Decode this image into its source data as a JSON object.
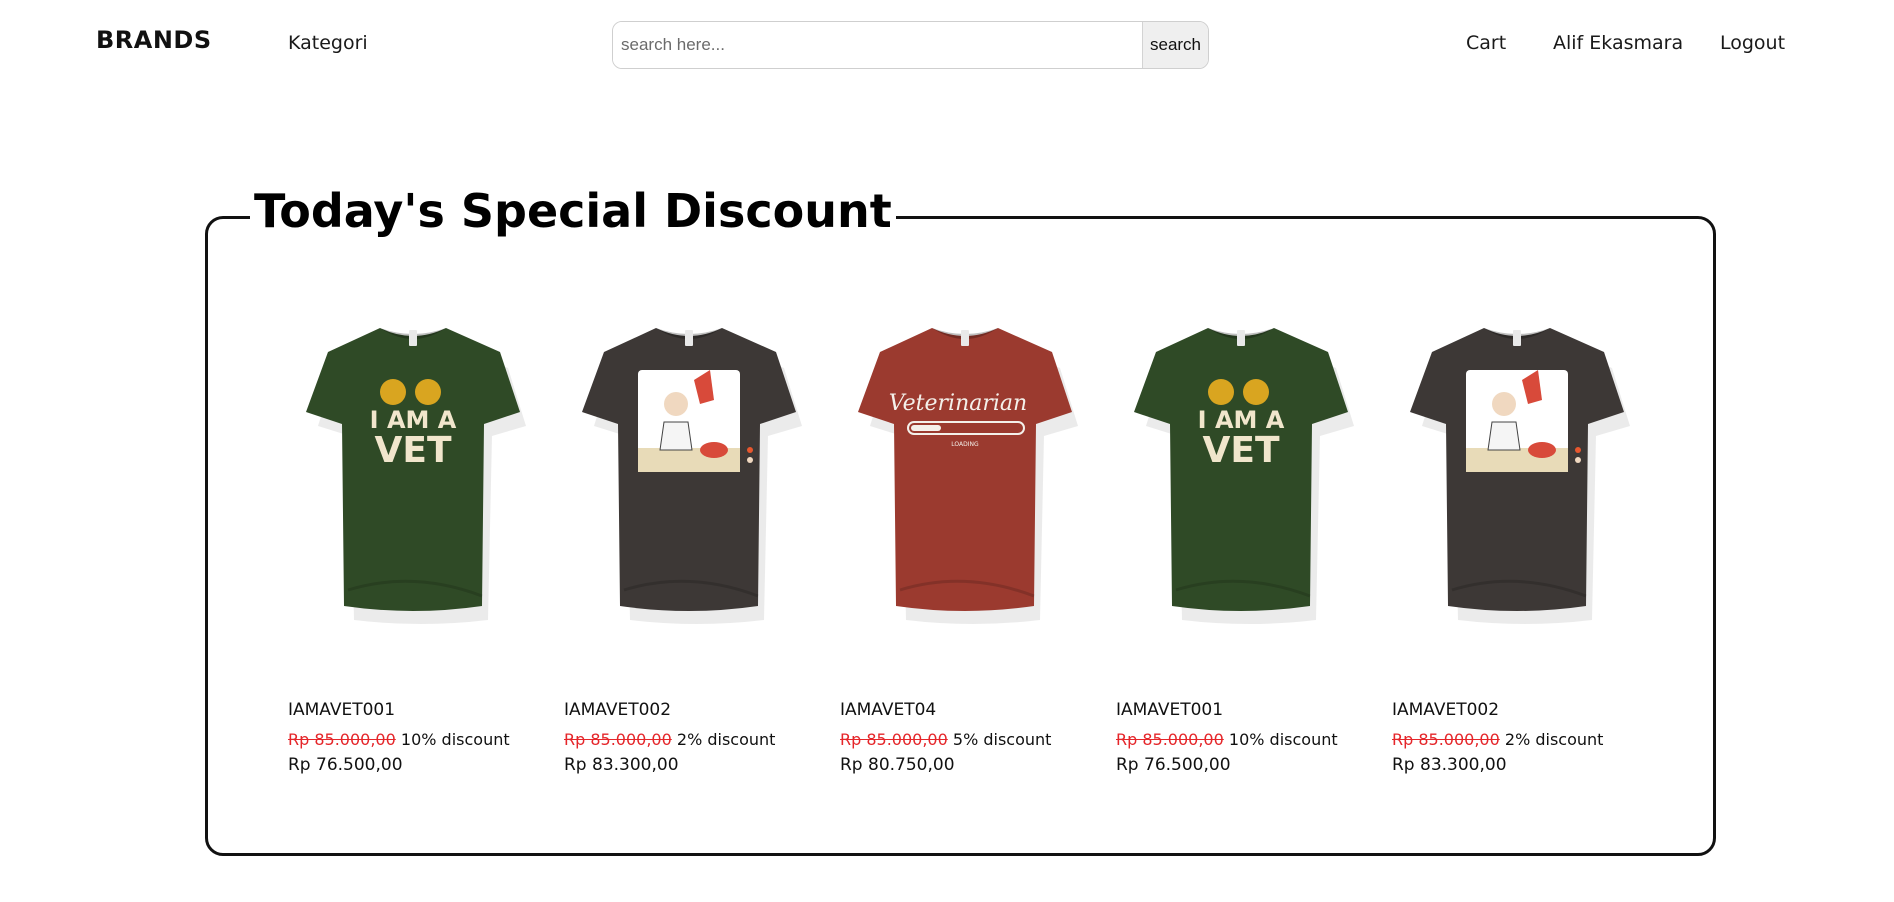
{
  "nav": {
    "brand": "BRANDS",
    "kategori": "Kategori",
    "search_placeholder": "search here...",
    "search_button": "search",
    "cart": "Cart",
    "user": "Alif Ekasmara",
    "logout": "Logout"
  },
  "section": {
    "title": "Today's Special Discount"
  },
  "products": [
    {
      "name": "IAMAVET001",
      "old_price": "Rp 85.000,00",
      "discount": "10% discount",
      "price": "Rp 76.500,00",
      "color": "#2f4a26",
      "design": "i-am-a-vet",
      "design_text_1": "I AM A",
      "design_text_2": "VET"
    },
    {
      "name": "IAMAVET002",
      "old_price": "Rp 85.000,00",
      "discount": "2% discount",
      "price": "Rp 83.300,00",
      "color": "#3d3836",
      "design": "doctor-illustration"
    },
    {
      "name": "IAMAVET04",
      "old_price": "Rp 85.000,00",
      "discount": "5% discount",
      "price": "Rp 80.750,00",
      "color": "#9b3a2f",
      "design": "veterinarian-loading",
      "design_text_1": "Veterinarian",
      "design_text_2": "LOADING"
    },
    {
      "name": "IAMAVET001",
      "old_price": "Rp 85.000,00",
      "discount": "10% discount",
      "price": "Rp 76.500,00",
      "color": "#2f4a26",
      "design": "i-am-a-vet",
      "design_text_1": "I AM A",
      "design_text_2": "VET"
    },
    {
      "name": "IAMAVET002",
      "old_price": "Rp 85.000,00",
      "discount": "2% discount",
      "price": "Rp 83.300,00",
      "color": "#3d3836",
      "design": "doctor-illustration"
    }
  ]
}
